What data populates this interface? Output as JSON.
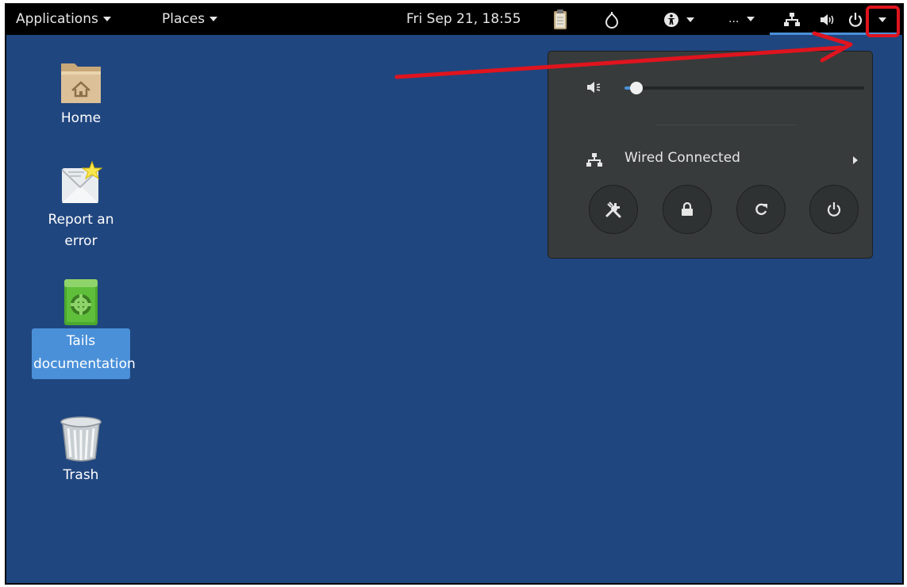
{
  "topbar": {
    "applications_label": "Applications",
    "places_label": "Places",
    "clock": "Fri Sep 21, 18:55",
    "ellipsis": "..."
  },
  "desktop": {
    "icons": [
      {
        "label": "Home",
        "icon": "home-folder-icon"
      },
      {
        "label": "Report an error",
        "icon": "report-error-icon"
      },
      {
        "label": "Tails documentation",
        "icon": "documentation-book-icon",
        "selected": true
      },
      {
        "label": "Trash",
        "icon": "trash-icon"
      }
    ]
  },
  "system_menu": {
    "volume_level": 0.05,
    "network_label": "Wired Connected",
    "buttons": [
      "settings-icon",
      "lock-icon",
      "restart-icon",
      "power-icon"
    ]
  },
  "colors": {
    "desktop_bg": "#20467f",
    "panel_bg": "#000000",
    "popover_bg": "#373b3c",
    "accent": "#4a90d9",
    "annotation": "#e0141e"
  }
}
